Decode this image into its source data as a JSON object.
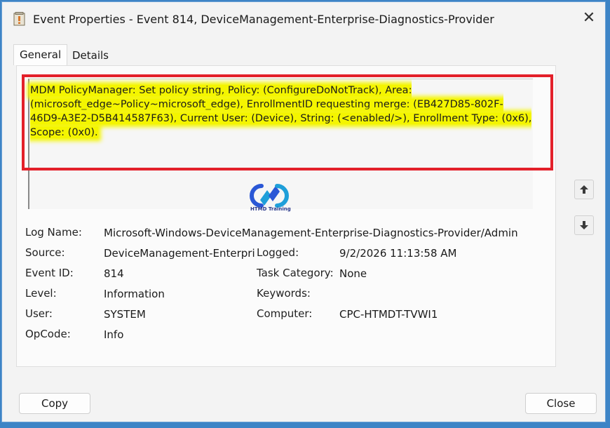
{
  "window": {
    "title": "Event Properties - Event 814, DeviceManagement-Enterprise-Diagnostics-Provider",
    "close_glyph": "✕"
  },
  "tabs": [
    {
      "label": "General",
      "selected": true
    },
    {
      "label": "Details",
      "selected": false
    }
  ],
  "description": {
    "text": "MDM PolicyManager: Set policy string, Policy: (ConfigureDoNotTrack), Area: (microsoft_edge~Policy~microsoft_edge), EnrollmentID requesting merge: (EB427D85-802F-46D9-A3E2-D5B414587F63), Current User: (Device), String: (<enabled/>), Enrollment Type: (0x6), Scope: (0x0).",
    "highlight_color": "#f4f500",
    "frame_color": "#e3202a"
  },
  "watermark": {
    "caption": "HTMD Training"
  },
  "fields": {
    "log_name": {
      "label": "Log Name:",
      "value": "Microsoft-Windows-DeviceManagement-Enterprise-Diagnostics-Provider/Admin"
    },
    "source": {
      "label": "Source:",
      "value": "DeviceManagement-Enterpri"
    },
    "logged": {
      "label": "Logged:",
      "value": "9/2/2026 11:13:58 AM"
    },
    "event_id": {
      "label": "Event ID:",
      "value": "814"
    },
    "task_category": {
      "label": "Task Category:",
      "value": "None"
    },
    "level": {
      "label": "Level:",
      "value": "Information"
    },
    "keywords": {
      "label": "Keywords:",
      "value": ""
    },
    "user": {
      "label": "User:",
      "value": "SYSTEM"
    },
    "computer": {
      "label": "Computer:",
      "value": "CPC-HTMDT-TVWI1"
    },
    "opcode": {
      "label": "OpCode:",
      "value": "Info"
    }
  },
  "nav": {
    "up_icon": "arrow-up-icon",
    "down_icon": "arrow-down-icon"
  },
  "buttons": {
    "copy": "Copy",
    "close": "Close"
  },
  "colors": {
    "frame_background": "#3d84c6",
    "window_background": "#f3f3f3"
  }
}
